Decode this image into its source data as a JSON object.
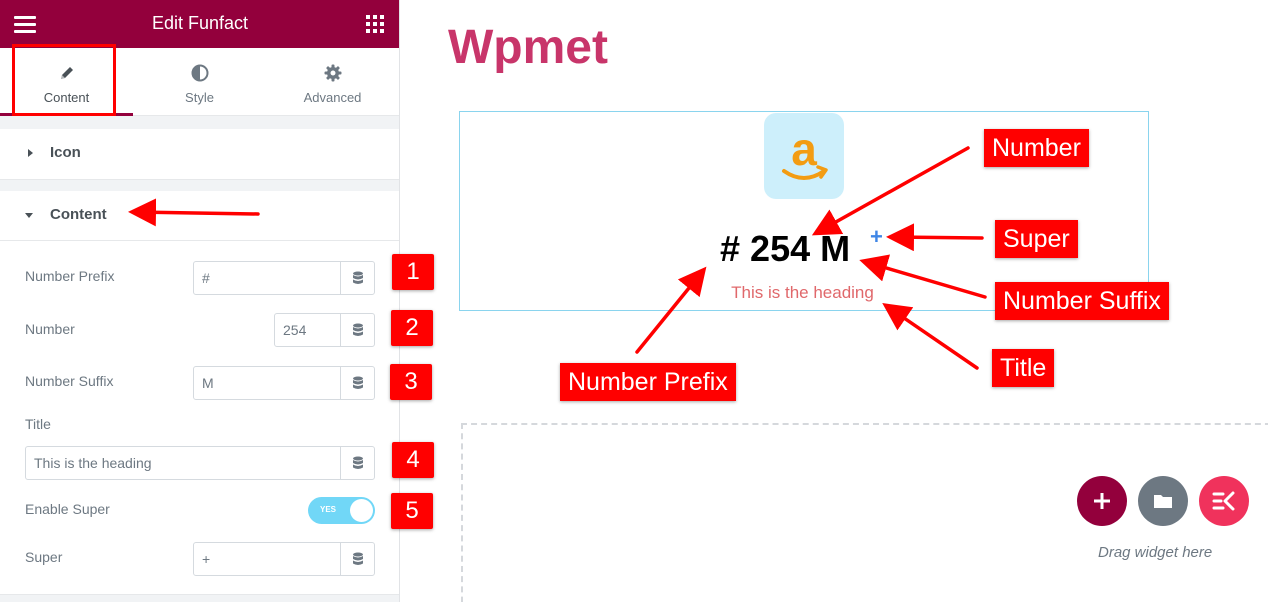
{
  "editor": {
    "title": "Edit Funfact",
    "tabs": [
      {
        "label": "Content",
        "icon": "pencil-icon",
        "active": true
      },
      {
        "label": "Style",
        "icon": "half-circle-icon",
        "active": false
      },
      {
        "label": "Advanced",
        "icon": "gear-icon",
        "active": false
      }
    ],
    "sections": {
      "icon": {
        "label": "Icon",
        "expanded": false
      },
      "content": {
        "label": "Content",
        "expanded": true
      }
    },
    "controls": {
      "number_prefix": {
        "label": "Number Prefix",
        "value": "#"
      },
      "number": {
        "label": "Number",
        "value": "254"
      },
      "number_suffix": {
        "label": "Number Suffix",
        "value": "M"
      },
      "title": {
        "label": "Title",
        "value": "This is the heading"
      },
      "enable_super": {
        "label": "Enable Super",
        "toggle_text": "YES",
        "enabled": true
      },
      "super": {
        "label": "Super",
        "value": "+"
      }
    },
    "step_badges": [
      "1",
      "2",
      "3",
      "4",
      "5"
    ]
  },
  "preview": {
    "brand": "Wpmet",
    "funfact": {
      "prefix": "#",
      "number": "254",
      "suffix": "M",
      "super": "+",
      "heading": "This is the heading"
    },
    "callouts": {
      "number": "Number",
      "super": "Super",
      "number_suffix": "Number Suffix",
      "title": "Title",
      "number_prefix": "Number Prefix"
    },
    "drop_zone": {
      "text": "Drag widget here"
    }
  },
  "colors": {
    "topbar": "#93003c",
    "brand": "#c8356a",
    "annotation": "#ff0000",
    "toggle_on": "#71d7f7",
    "super": "#3f86e6",
    "heading": "#e0686b",
    "add_button": "#93003c",
    "folder_button": "#6d7882",
    "elementskit_button": "#f0325c"
  }
}
